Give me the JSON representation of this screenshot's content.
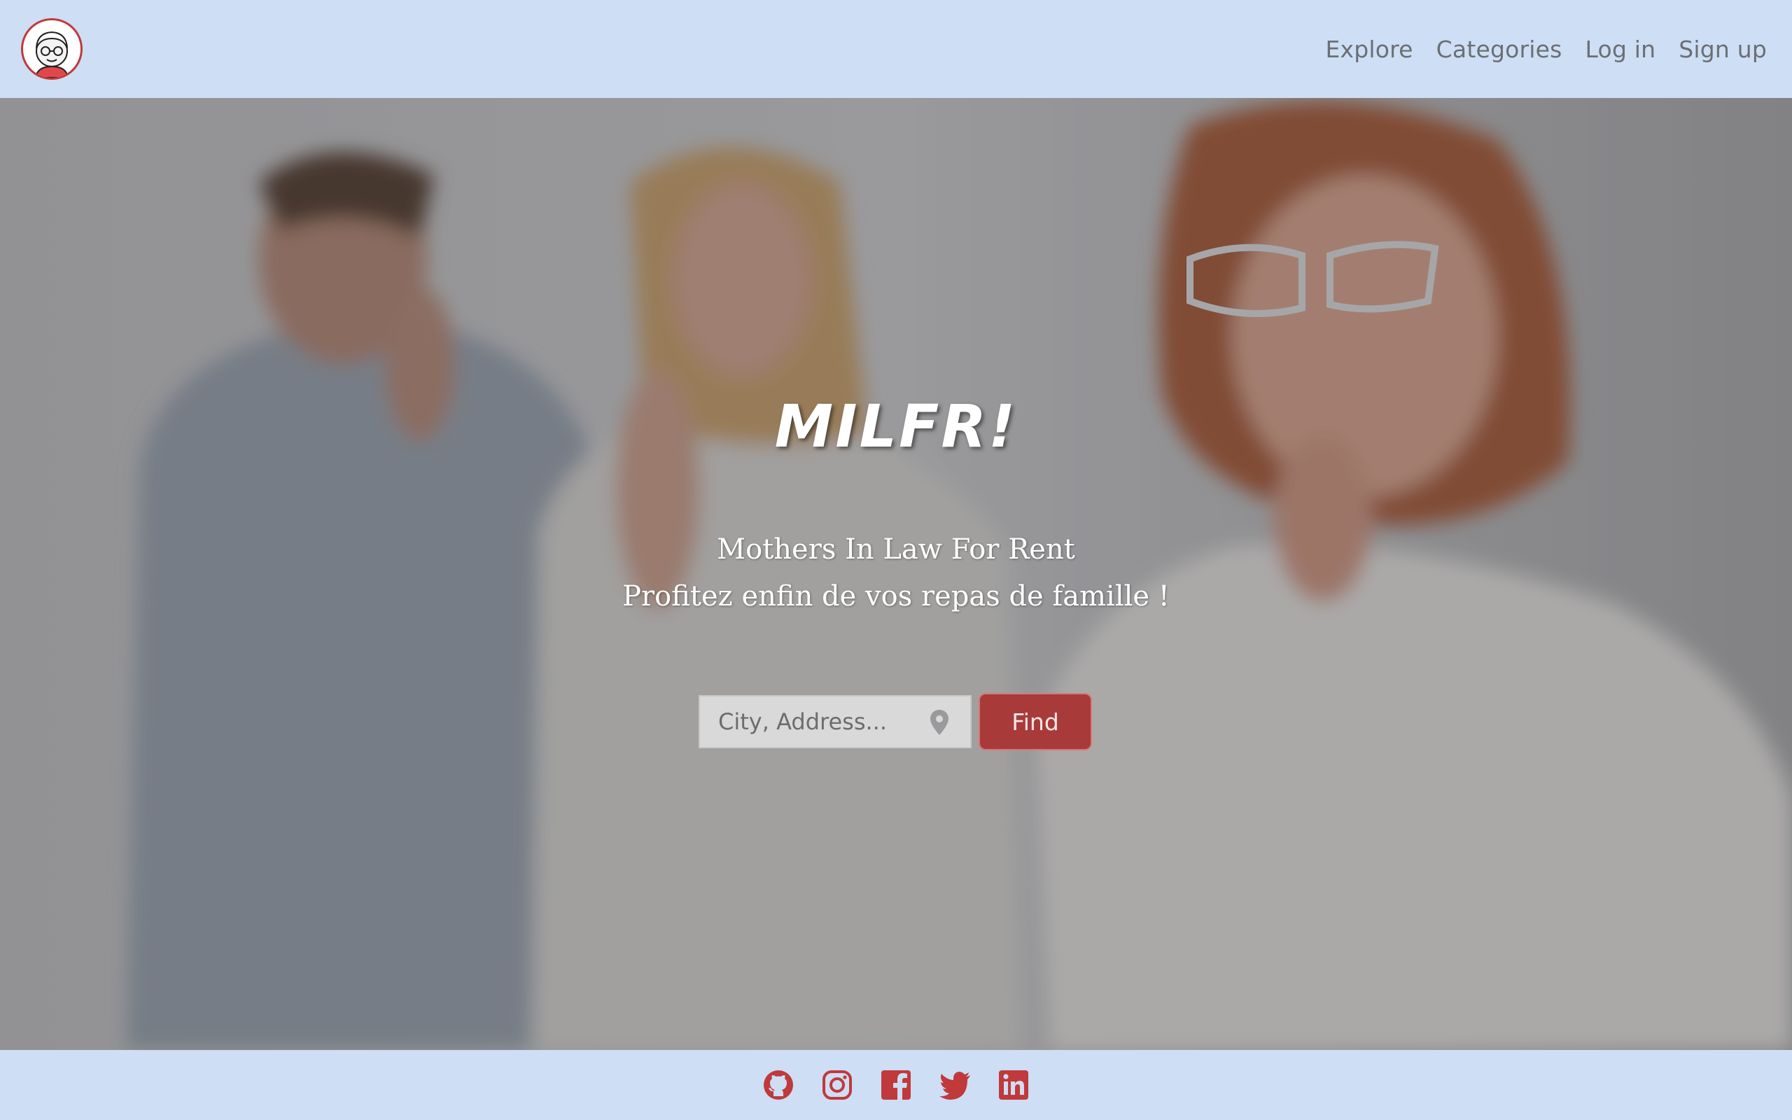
{
  "header": {
    "logo_icon": "grandmother-avatar-icon",
    "nav": [
      {
        "label": "Explore"
      },
      {
        "label": "Categories"
      },
      {
        "label": "Log in"
      },
      {
        "label": "Sign up"
      }
    ]
  },
  "hero": {
    "brand": "MILFR!",
    "tagline_line1": "Mothers In Law For Rent",
    "tagline_line2": "Profitez enfin de vos repas de famille !",
    "search": {
      "placeholder": "City, Address...",
      "value": "",
      "location_icon": "map-pin-icon"
    },
    "find_label": "Find"
  },
  "footer": {
    "social": [
      "github-icon",
      "instagram-icon",
      "facebook-icon",
      "twitter-icon",
      "linkedin-icon"
    ]
  },
  "colors": {
    "bar_bg": "#cedef4",
    "accent": "#a83a3a",
    "nav_text": "#6b6f75",
    "icon_red": "#c0393b"
  }
}
